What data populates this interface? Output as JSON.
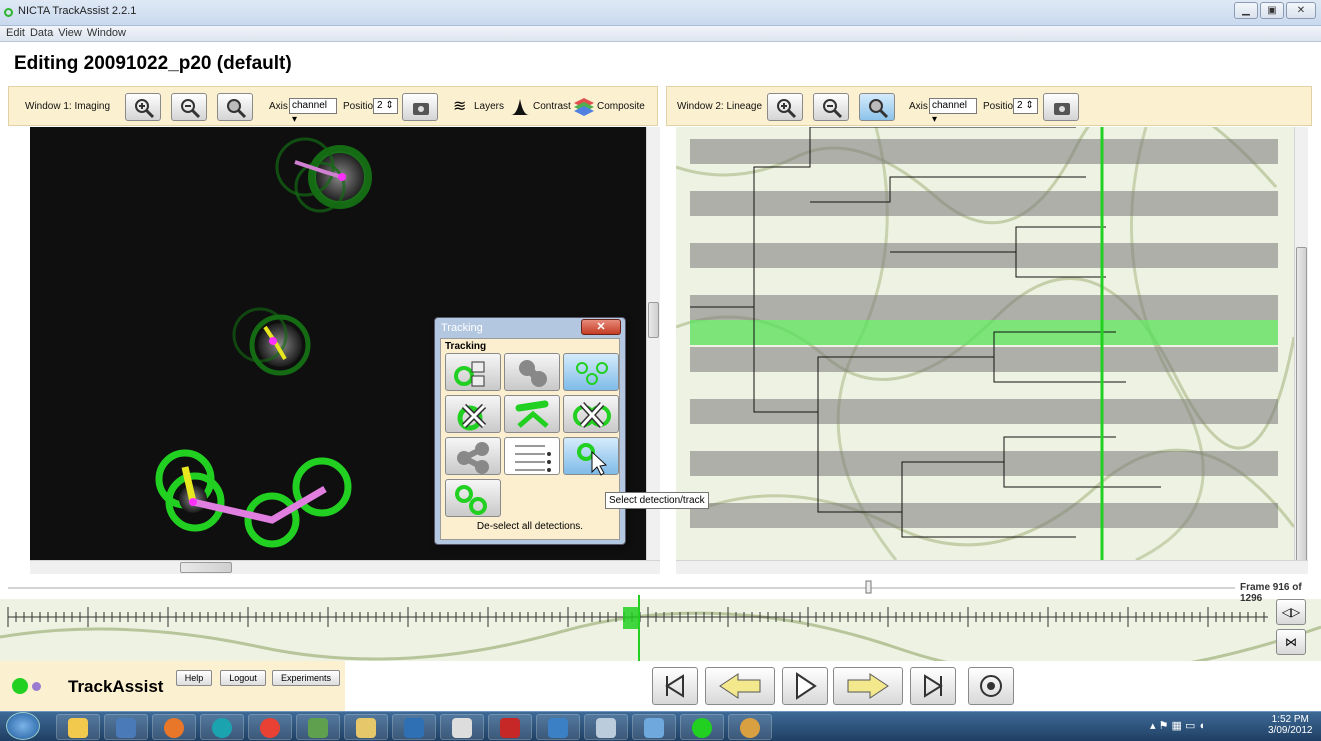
{
  "window": {
    "title": "NICTA TrackAssist 2.2.1"
  },
  "menu": [
    "Edit",
    "Data",
    "View",
    "Window"
  ],
  "heading": "Editing 20091022_p20 (default)",
  "window1": {
    "title": "Window 1: Imaging",
    "axis_label": "Axis",
    "axis_value": "channel",
    "position_label": "Position",
    "position_value": "2",
    "layers_label": "Layers",
    "contrast_label": "Contrast",
    "composite_label": "Composite"
  },
  "window2": {
    "title": "Window 2: Lineage",
    "axis_label": "Axis",
    "axis_value": "channel",
    "position_label": "Position",
    "position_value": "2"
  },
  "tracking": {
    "window_title": "Tracking",
    "section_title": "Tracking",
    "status": "De-select all detections.",
    "tooltip": "Select detection/track"
  },
  "frame": {
    "label": "Frame 916 of 1296",
    "current": 916,
    "total": 1296
  },
  "footer": {
    "app_name": "TrackAssist",
    "help": "Help",
    "logout": "Logout",
    "experiments": "Experiments"
  },
  "taskbar": {
    "time": "1:52 PM",
    "date": "3/09/2012"
  },
  "colors": {
    "toolbar_bg": "#fbf0cf",
    "track_green": "#22d022",
    "track_pink": "#e07fe0",
    "accent_yellow": "#e8e820"
  }
}
